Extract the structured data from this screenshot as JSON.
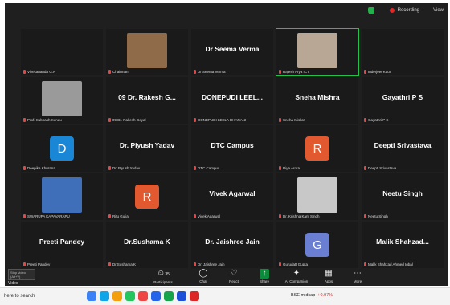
{
  "topbar": {
    "recording": "Recording",
    "view": "View"
  },
  "tiles": [
    {
      "caption": "Vivekananda G.N",
      "big": ""
    },
    {
      "caption": "Chairman",
      "big": "",
      "photo": "#8f6b4a"
    },
    {
      "caption": "Dr Seema Verma",
      "big": "Dr Seema Verma"
    },
    {
      "caption": "Rajesh Arya ICT",
      "big": "",
      "photo": "#b9a795",
      "active": true
    },
    {
      "caption": "Inderjeet Kaur",
      "big": ""
    },
    {
      "caption": "Prof. Subhash Kundu",
      "big": "",
      "photo": "#9a9a9a"
    },
    {
      "caption": "09 Dr. Rakesh Goyal",
      "big": "09 Dr. Rakesh G..."
    },
    {
      "caption": "DONEPUDI LEELA DHARANI",
      "big": "DONEPUDI LEEL..."
    },
    {
      "caption": "Sneha Mishra",
      "big": "Sneha Mishra"
    },
    {
      "caption": "Gayathri P S",
      "big": "Gayathri P S"
    },
    {
      "caption": "Deepika Khurana",
      "big": "",
      "avatar": "D",
      "color": "#1a87d6"
    },
    {
      "caption": "Dr. Piyush Yadav",
      "big": "Dr. Piyush Yadav"
    },
    {
      "caption": "DTC Campus",
      "big": "DTC Campus"
    },
    {
      "caption": "Riya Arora",
      "big": "",
      "avatar": "R",
      "color": "#e2582f"
    },
    {
      "caption": "Deepti Srivastava",
      "big": "Deepti Srivastava"
    },
    {
      "caption": "SWARUPA KAPAVARAPU",
      "big": "",
      "photo": "#3e6fb8"
    },
    {
      "caption": "Ritu Gulia",
      "big": "",
      "avatar": "R",
      "color": "#e2582f"
    },
    {
      "caption": "Vivek Agarwal",
      "big": "Vivek Agarwal"
    },
    {
      "caption": "Dr. Krishna Kant Singh",
      "big": "",
      "photo": "#c8c8c8"
    },
    {
      "caption": "Neetu Singh",
      "big": "Neetu Singh"
    },
    {
      "caption": "Preeti Pandey",
      "big": "Preeti Pandey"
    },
    {
      "caption": "Dr.Sushama K",
      "big": "Dr.Sushama K"
    },
    {
      "caption": "Dr. Jaishree Jain",
      "big": "Dr. Jaishree Jain"
    },
    {
      "caption": "Gurudatt Gupta",
      "big": "",
      "avatar": "G",
      "color": "#6a7fd1"
    },
    {
      "caption": "Malik Shahzad Ahmed Iqbal",
      "big": "Malik Shahzad..."
    }
  ],
  "toolbar": {
    "stop_video": "Stop video (Alt+V)",
    "video": "Video",
    "participants": "Participants",
    "participants_count": "35",
    "chat": "Chat",
    "react": "React",
    "share": "Share",
    "ai_companion": "AI Companion",
    "apps": "Apps",
    "more": "More"
  },
  "taskbar": {
    "search": "here to search",
    "stock": "BSE midcap",
    "stock_change": "+0.97%"
  }
}
